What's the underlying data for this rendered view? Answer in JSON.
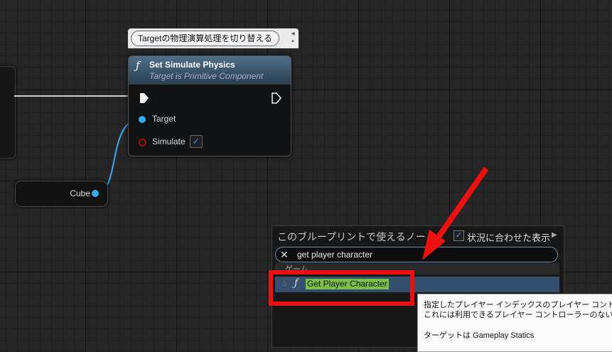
{
  "comment": {
    "text": "Targetの物理演算処理を切り替える"
  },
  "set_node": {
    "title": "Set Simulate Physics",
    "subtitle": "Target is Primitive Component",
    "func_icon": "ƒ",
    "pins": {
      "target": "Target",
      "simulate": "Simulate"
    },
    "simulate_checked": "✓"
  },
  "cube_node": {
    "label": "Cube"
  },
  "action_menu": {
    "title": "このブループリントで使えるノード",
    "context_sensitive_label": "状況に合わせた表示",
    "context_check": "✓",
    "context_arrow": "▶",
    "search": {
      "value": "get player character",
      "clear_icon": "✕"
    },
    "category": "ゲーム",
    "results": [
      {
        "star": "☆",
        "func_icon": "ƒ",
        "label": "Get Player Character"
      }
    ]
  },
  "tooltip": {
    "line1": "指定したプレイヤー インデックスのプレイヤー コント",
    "line2": "これには利用できるプレイヤー コントローラーのない",
    "target_line": "ターゲットは Gameplay Statics"
  },
  "colors": {
    "annotation_red": "#ee1010",
    "object_pin_blue": "#3aa8f0",
    "bool_pin_red": "#9c1111",
    "search_highlight": "#7ac04a",
    "node_header": "#4e6f8a"
  },
  "icons": [
    "function-icon",
    "exec-pin-icon",
    "clear-icon",
    "star-icon",
    "checkbox-icon",
    "pin-icon"
  ]
}
